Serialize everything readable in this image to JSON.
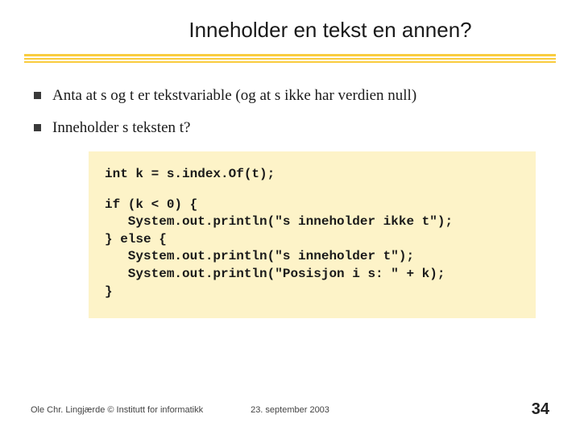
{
  "title": "Inneholder en tekst en annen?",
  "bullets": [
    "Anta at s og t er tekstvariable (og at s ikke har verdien null)",
    "Inneholder s teksten t?"
  ],
  "code": {
    "l0": "int k = s.index.Of(t);",
    "l1": "if (k < 0) {",
    "l2": "   System.out.println(\"s inneholder ikke t\");",
    "l3": "} else {",
    "l4": "   System.out.println(\"s inneholder t\");",
    "l5": "   System.out.println(\"Posisjon i s: \" + k);",
    "l6": "}"
  },
  "footer": {
    "left": "Ole Chr. Lingjærde © Institutt for informatikk",
    "center": "23. september 2003",
    "page": "34"
  }
}
